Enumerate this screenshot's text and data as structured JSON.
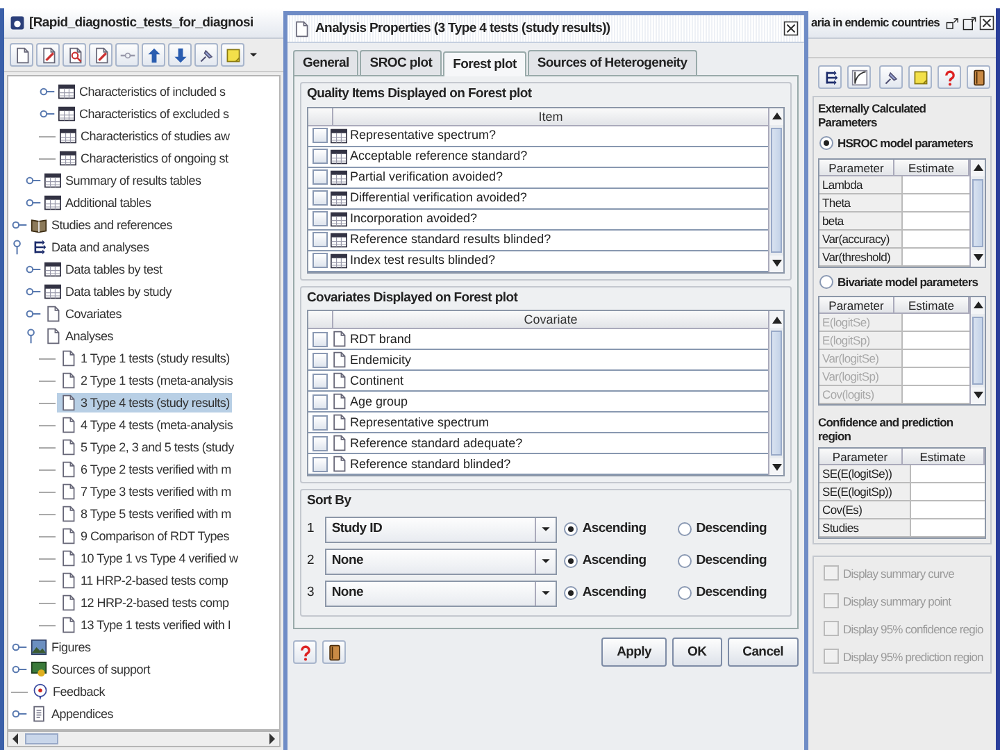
{
  "app_window": {
    "title_parts": [
      "[Rapid_diagnostic_tests_for_diagnosi",
      "aria in endemic countries"
    ]
  },
  "tree": [
    {
      "children": [
        {
          "children": [
            {
              "label": "Characteristics of included s",
              "kind": "table",
              "expanded": false,
              "selected": false
            },
            {
              "label": "Characteristics of excluded s",
              "kind": "table",
              "expanded": false,
              "selected": false
            },
            {
              "label": "Characteristics of studies aw",
              "kind": "table",
              "selected": false
            },
            {
              "label": "Characteristics of ongoing st",
              "kind": "table",
              "selected": false
            }
          ]
        },
        {
          "label": "Summary of results tables",
          "kind": "table",
          "expanded": false,
          "selected": false
        },
        {
          "label": "Additional tables",
          "kind": "table",
          "expanded": false,
          "selected": false
        }
      ]
    },
    {
      "label": "Studies and references",
      "kind": "book",
      "expanded": false,
      "selected": false
    },
    {
      "label": "Data and analyses",
      "kind": "structure",
      "expanded": true,
      "selected": false,
      "children": [
        {
          "label": "Data tables by test",
          "kind": "table",
          "expanded": false,
          "selected": false
        },
        {
          "label": "Data tables by study",
          "kind": "table",
          "expanded": false,
          "selected": false
        },
        {
          "label": "Covariates",
          "kind": "document",
          "expanded": false,
          "selected": false
        },
        {
          "label": "Analyses",
          "kind": "document",
          "expanded": true,
          "selected": false,
          "children": [
            {
              "label": "1 Type 1 tests (study results)",
              "kind": "document",
              "selected": false
            },
            {
              "label": "2 Type 1 tests (meta-analysis",
              "kind": "document",
              "selected": false
            },
            {
              "label": "3 Type 4 tests (study results)",
              "kind": "document",
              "selected": true
            },
            {
              "label": "4 Type 4 tests (meta-analysis",
              "kind": "document",
              "selected": false
            },
            {
              "label": "5 Type 2, 3 and 5 tests (study",
              "kind": "document",
              "selected": false
            },
            {
              "label": "6 Type 2 tests verified with m",
              "kind": "document",
              "selected": false
            },
            {
              "label": "7 Type 3 tests verified with m",
              "kind": "document",
              "selected": false
            },
            {
              "label": "8 Type 5 tests verified with m",
              "kind": "document",
              "selected": false
            },
            {
              "label": "9 Comparison of RDT Types",
              "kind": "document",
              "selected": false
            },
            {
              "label": "10 Type 1 vs Type 4 verified w",
              "kind": "document",
              "selected": false
            },
            {
              "label": "11 HRP-2-based tests comp",
              "kind": "document",
              "selected": false
            },
            {
              "label": "12 HRP-2-based tests comp",
              "kind": "document",
              "selected": false
            },
            {
              "label": "13 Type 1 tests verified with I",
              "kind": "document",
              "selected": false
            }
          ]
        }
      ]
    },
    {
      "label": "Figures",
      "kind": "picture",
      "expanded": false,
      "selected": false
    },
    {
      "label": "Sources of support",
      "kind": "support",
      "expanded": false,
      "selected": false
    },
    {
      "label": "Feedback",
      "kind": "feedback",
      "selected": false
    },
    {
      "label": "Appendices",
      "kind": "appendix",
      "expanded": false,
      "selected": false
    }
  ],
  "dialog": {
    "title": "Analysis Properties (3 Type 4 tests (study results))",
    "tabs": [
      {
        "label": "General",
        "selected": false
      },
      {
        "label": "SROC plot",
        "selected": false
      },
      {
        "label": "Forest plot",
        "selected": true
      },
      {
        "label": "Sources of Heterogeneity",
        "selected": false
      }
    ],
    "quality_items": {
      "legend": "Quality Items Displayed on Forest plot",
      "column": "Item",
      "rows": [
        {
          "label": "Representative spectrum?",
          "checked": false
        },
        {
          "label": "Acceptable reference standard?",
          "checked": false
        },
        {
          "label": "Partial verification avoided?",
          "checked": false
        },
        {
          "label": "Differential verification avoided?",
          "checked": false
        },
        {
          "label": "Incorporation avoided?",
          "checked": false
        },
        {
          "label": "Reference standard results blinded?",
          "checked": false
        },
        {
          "label": "Index test results blinded?",
          "checked": false
        }
      ]
    },
    "covariates": {
      "legend": "Covariates Displayed on Forest plot",
      "column": "Covariate",
      "rows": [
        {
          "label": "RDT brand",
          "checked": false
        },
        {
          "label": "Endemicity",
          "checked": false
        },
        {
          "label": "Continent",
          "checked": false
        },
        {
          "label": "Age group",
          "checked": false
        },
        {
          "label": "Representative spectrum",
          "checked": false
        },
        {
          "label": "Reference standard adequate?",
          "checked": false
        },
        {
          "label": "Reference standard blinded?",
          "checked": false
        }
      ]
    },
    "sort_by": {
      "legend": "Sort By",
      "rows": [
        {
          "number": "1",
          "value": "Study ID",
          "order": [
            {
              "label": "Ascending",
              "selected": true
            },
            {
              "label": "Descending",
              "selected": false
            }
          ]
        },
        {
          "number": "2",
          "value": "None",
          "order": [
            {
              "label": "Ascending",
              "selected": true
            },
            {
              "label": "Descending",
              "selected": false
            }
          ]
        },
        {
          "number": "3",
          "value": "None",
          "order": [
            {
              "label": "Ascending",
              "selected": true
            },
            {
              "label": "Descending",
              "selected": false
            }
          ]
        }
      ]
    },
    "buttons": [
      "Apply",
      "OK",
      "Cancel"
    ]
  },
  "right_panel": {
    "legend": "Externally Calculated Parameters",
    "models": [
      {
        "label": "HSROC model parameters",
        "selected": true,
        "columns": [
          "Parameter",
          "Estimate"
        ],
        "rows": [
          "Lambda",
          "Theta",
          "beta",
          "Var(accuracy)",
          "Var(threshold)"
        ]
      },
      {
        "label": "Bivariate model parameters",
        "selected": false,
        "columns": [
          "Parameter",
          "Estimate"
        ],
        "rows": [
          "E(logitSe)",
          "E(logitSp)",
          "Var(logitSe)",
          "Var(logitSp)",
          "Cov(logits)"
        ]
      }
    ],
    "confidence": {
      "heading": "Confidence and prediction region",
      "columns": [
        "Parameter",
        "Estimate"
      ],
      "rows": [
        "SE(E(logitSe))",
        "SE(E(logitSp))",
        "Cov(Es)",
        "Studies"
      ]
    },
    "display_options": [
      {
        "label": "Display summary curve",
        "checked": false,
        "disabled": true
      },
      {
        "label": "Display summary point",
        "checked": false,
        "disabled": true
      },
      {
        "label": "Display 95% confidence regio",
        "checked": false,
        "disabled": true
      },
      {
        "label": "Display 95% prediction region",
        "checked": false,
        "disabled": true
      }
    ]
  }
}
